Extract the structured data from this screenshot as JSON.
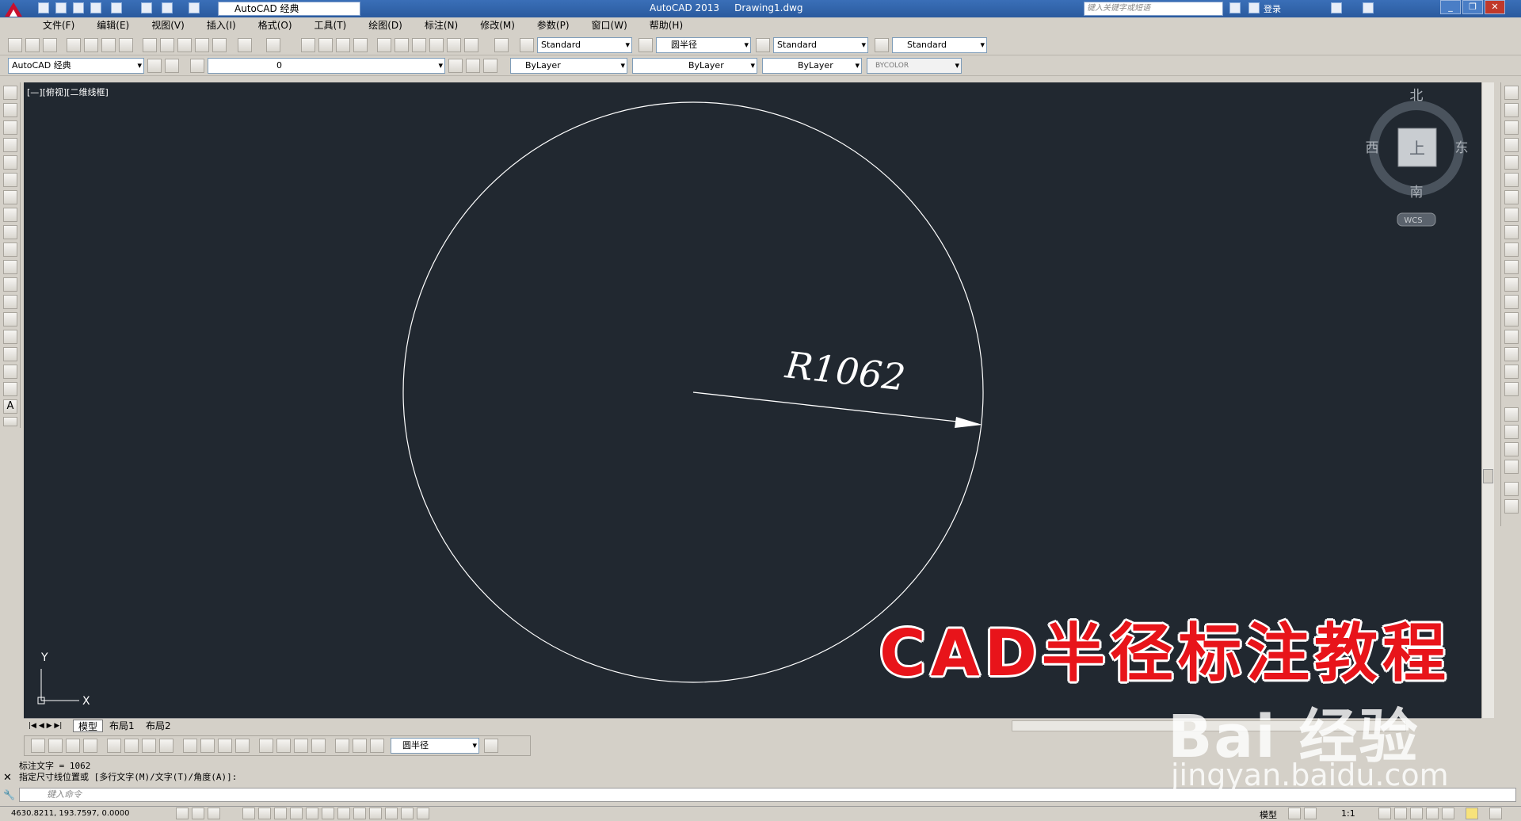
{
  "window": {
    "app_name": "AutoCAD 2013",
    "file_name": "Drawing1.dwg",
    "workspace": "AutoCAD 经典",
    "search_placeholder": "键入关键字或短语",
    "login": "登录"
  },
  "menu": [
    "文件(F)",
    "编辑(E)",
    "视图(V)",
    "插入(I)",
    "格式(O)",
    "工具(T)",
    "绘图(D)",
    "标注(N)",
    "修改(M)",
    "参数(P)",
    "窗口(W)",
    "帮助(H)"
  ],
  "styles_toolbar": {
    "text_style": "Standard",
    "dim_style": "圆半径",
    "table_style": "Standard",
    "mleader_style": "Standard"
  },
  "layers_toolbar": {
    "workspace": "AutoCAD 经典",
    "layer": "0",
    "color": "ByLayer",
    "linetype": "ByLayer",
    "lineweight": "ByLayer",
    "plotstyle": "BYCOLOR"
  },
  "viewport": {
    "label": "[—][俯视][二维线框]",
    "dimension_text": "R1062",
    "circle_radius_value": 1062
  },
  "viewcube": {
    "north": "北",
    "south": "南",
    "east": "东",
    "west": "西",
    "face": "上",
    "ucs": "WCS"
  },
  "ucs_icon": {
    "x": "X",
    "y": "Y"
  },
  "tabs": [
    "模型",
    "布局1",
    "布局2"
  ],
  "dim_toolbar": {
    "dim_style": "圆半径"
  },
  "command": {
    "history_line1": "标注文字 = 1062",
    "history_line2": "指定尺寸线位置或 [多行文字(M)/文字(T)/角度(A)]:",
    "input_placeholder": "键入命令"
  },
  "status": {
    "coordinates": "4630.8211, 193.7597, 0.0000",
    "space": "模型",
    "scale": "1:1"
  },
  "overlay": {
    "caption": "CAD半径标注教程",
    "watermark_logo": "Bai 经验",
    "watermark_url": "jingyan.baidu.com"
  },
  "colors": {
    "canvas": "#212830",
    "caption": "#e8141a",
    "titlebar": "#2a5a9e"
  }
}
